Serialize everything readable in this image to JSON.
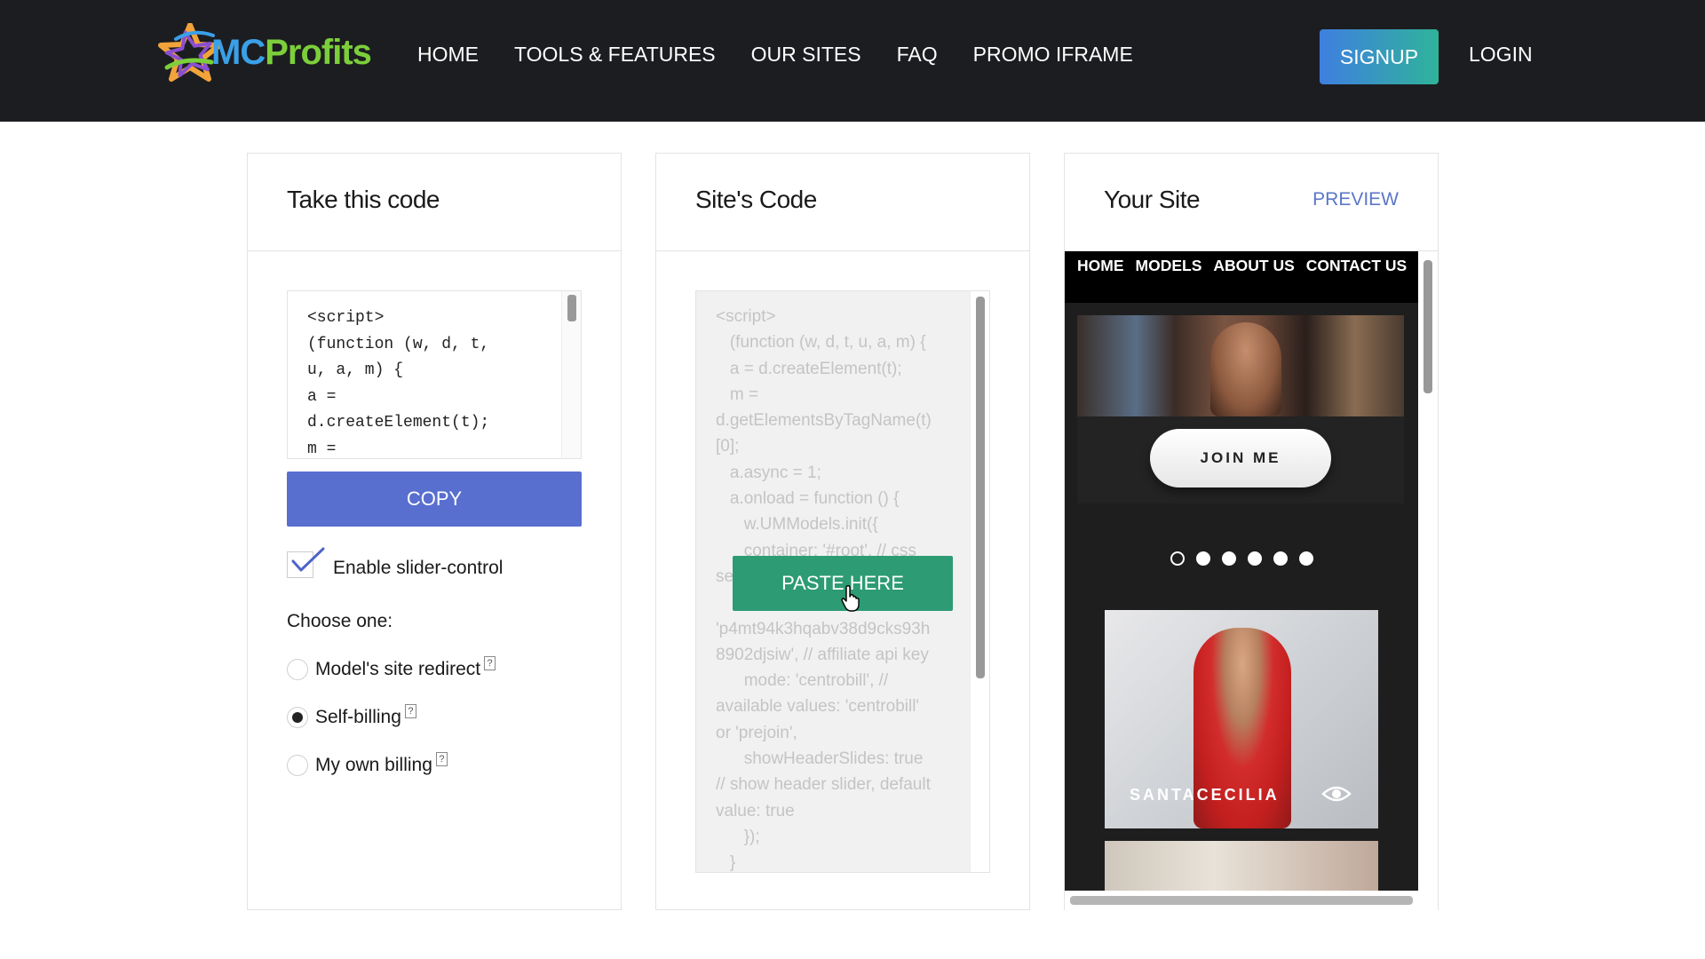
{
  "brand": {
    "logo_mc": "MC",
    "logo_profits": "Profits",
    "colors": {
      "blue": "#3aa0e8",
      "green": "#7ccf3b",
      "orange": "#f2a33a",
      "purple": "#8a4fd0"
    }
  },
  "nav": {
    "items": [
      "HOME",
      "TOOLS & FEATURES",
      "OUR SITES",
      "FAQ",
      "PROMO IFRAME"
    ],
    "signup": "SIGNUP",
    "login": "LOGIN"
  },
  "panel_take": {
    "title": "Take this code",
    "code": "<script>\n(function (w, d, t,\nu, a, m) {\na =\nd.createElement(t);\nm =",
    "copy_label": "COPY",
    "checkbox_label": "Enable slider-control",
    "checkbox_checked": true,
    "choose_label": "Choose one:",
    "options": [
      {
        "label": "Model's site redirect",
        "help": "?",
        "checked": false
      },
      {
        "label": "Self-billing",
        "help": "?",
        "checked": true
      },
      {
        "label": "My own billing",
        "help": "?",
        "checked": false
      }
    ]
  },
  "panel_site": {
    "title": "Site's Code",
    "code": "<script>\n   (function (w, d, t, u, a, m) {\n   a = d.createElement(t);\n   m =\nd.getElementsByTagName(t)\n[0];\n   a.async = 1;\n   a.onload = function () {\n      w.UMModels.init({\n      container: '#root', // css\nse\n\n'p4mt94k3hqabv38d9cks93h\n8902djsiw', // affiliate api key\n      mode: 'centrobill', //\navailable values: 'centrobill'\nor 'prejoin',\n      showHeaderSlides: true\n// show header slider, default\nvalue: true\n      });\n   }",
    "paste_label": "PASTE HERE"
  },
  "panel_preview": {
    "title": "Your Site",
    "preview_label": "PREVIEW",
    "site_nav": [
      "HOME",
      "MODELS",
      "ABOUT US",
      "CONTACT US"
    ],
    "join_label": "JOIN ME",
    "dots_count": 6,
    "active_dot": 0,
    "model_name": "SANTACECILIA"
  }
}
